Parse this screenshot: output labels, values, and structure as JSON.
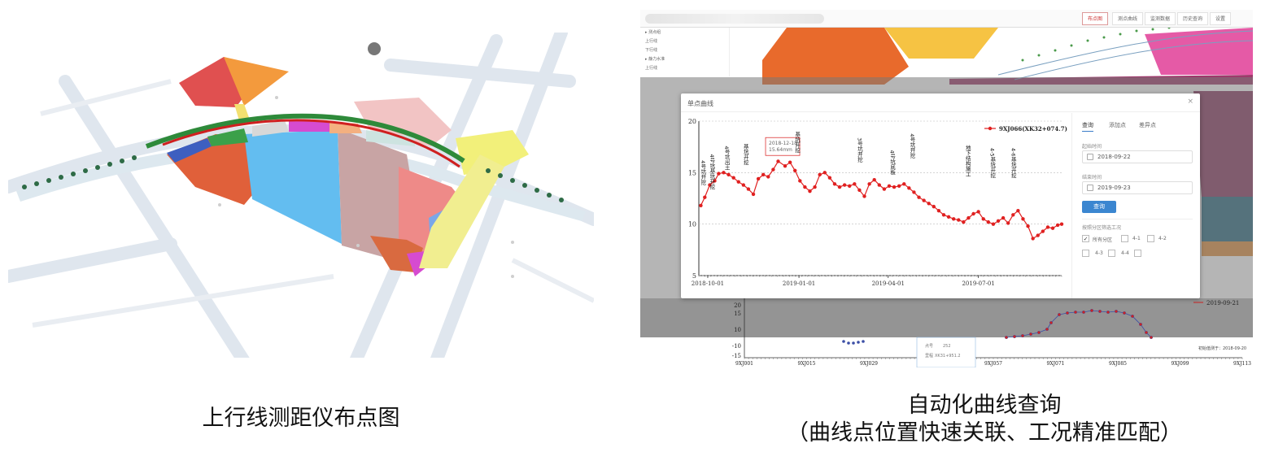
{
  "left_caption": "上行线测距仪布点图",
  "right_caption_line1": "自动化曲线查询",
  "right_caption_line2": "（曲线点位置快速关联、工况精准匹配）",
  "app_header": {
    "tabs": [
      "布点图",
      "测点曲线",
      "监测数据",
      "历史查询",
      "设置"
    ],
    "active_tab": 0
  },
  "sidebar": {
    "items": [
      "▸ 测点组",
      "上行线",
      "下行线",
      "▸ 静力水准",
      "上行线"
    ]
  },
  "modal": {
    "title": "单点曲线",
    "close": "×",
    "legend": "9XJ066(XK32+074.7)",
    "tooltip_date": "2018-12-18",
    "tooltip_value": "15.64mm",
    "y_ticks": [
      "20",
      "15",
      "10",
      "5"
    ],
    "x_ticks": [
      "2018-10-01",
      "2019-01-01",
      "2019-04-01",
      "2019-07-01"
    ]
  },
  "panel": {
    "tabs": [
      "查询",
      "添加点",
      "差异点"
    ],
    "start_label": "起始时间",
    "start_value": "2018-09-22",
    "end_label": "结束时间",
    "end_value": "2019-09-23",
    "query_button": "查询",
    "filter_label": "按照分区筛选工况",
    "checkboxes": [
      {
        "label": "所有分区",
        "checked": true
      },
      {
        "label": "4-1",
        "checked": false
      },
      {
        "label": "4-2",
        "checked": false
      },
      {
        "label": "4-3",
        "checked": false
      },
      {
        "label": "4-4",
        "checked": false
      }
    ]
  },
  "bottom_chart": {
    "legend": "2019-09-21",
    "y_ticks": [
      "20",
      "15",
      "10",
      "-10",
      "-15"
    ],
    "x_ticks": [
      "9XJ001",
      "9XJ015",
      "9XJ029",
      "9XJ043",
      "9XJ057",
      "9XJ071",
      "9XJ085",
      "9XJ099",
      "9XJ113"
    ],
    "note": "初始值测于：2018-09-20",
    "tooltip_row1_label": "点号",
    "tooltip_row1_value": "252",
    "tooltip_row2_label": "里程",
    "tooltip_row2_value": "XK31+951.2"
  },
  "chart_data": {
    "type": "line",
    "series": [
      {
        "name": "9XJ066(XK32+074.7)",
        "color": "#e02020",
        "x": [
          "2018-09-24",
          "2018-09-28",
          "2018-10-03",
          "2018-10-08",
          "2018-10-12",
          "2018-10-17",
          "2018-10-22",
          "2018-10-27",
          "2018-11-01",
          "2018-11-06",
          "2018-11-11",
          "2018-11-16",
          "2018-11-21",
          "2018-11-26",
          "2018-12-01",
          "2018-12-06",
          "2018-12-11",
          "2018-12-18",
          "2018-12-23",
          "2018-12-28",
          "2019-01-02",
          "2019-01-07",
          "2019-01-12",
          "2019-01-17",
          "2019-01-22",
          "2019-01-27",
          "2019-02-01",
          "2019-02-06",
          "2019-02-11",
          "2019-02-16",
          "2019-02-21",
          "2019-02-26",
          "2019-03-03",
          "2019-03-08",
          "2019-03-13",
          "2019-03-18",
          "2019-03-23",
          "2019-03-28",
          "2019-04-02",
          "2019-04-07",
          "2019-04-12",
          "2019-04-17",
          "2019-04-22",
          "2019-04-27",
          "2019-05-02",
          "2019-05-07",
          "2019-05-12",
          "2019-05-17",
          "2019-05-22",
          "2019-05-27",
          "2019-06-01",
          "2019-06-06",
          "2019-06-11",
          "2019-06-16",
          "2019-06-21",
          "2019-06-26",
          "2019-07-01",
          "2019-07-06",
          "2019-07-11",
          "2019-07-16",
          "2019-07-21",
          "2019-07-26",
          "2019-07-31",
          "2019-08-05",
          "2019-08-10",
          "2019-08-15",
          "2019-08-20",
          "2019-08-25",
          "2019-08-30",
          "2019-09-04",
          "2019-09-09",
          "2019-09-14",
          "2019-09-19",
          "2019-09-23"
        ],
        "y": [
          11.8,
          12.6,
          13.8,
          14.2,
          14.9,
          15.0,
          14.8,
          14.5,
          14.1,
          13.8,
          13.4,
          12.9,
          14.4,
          14.8,
          14.6,
          15.3,
          16.1,
          15.64,
          16.0,
          15.2,
          14.2,
          13.6,
          13.2,
          13.6,
          14.8,
          15.0,
          14.5,
          13.9,
          13.6,
          13.8,
          13.7,
          13.9,
          13.3,
          12.7,
          13.9,
          14.3,
          13.8,
          13.4,
          13.7,
          13.6,
          13.7,
          13.9,
          13.5,
          13.1,
          12.6,
          12.3,
          12.0,
          11.7,
          11.3,
          10.9,
          10.7,
          10.5,
          10.4,
          10.2,
          10.6,
          11.0,
          11.2,
          10.5,
          10.2,
          10.0,
          10.3,
          10.6,
          10.1,
          10.9,
          11.3,
          10.5,
          9.8,
          8.6,
          8.9,
          9.3,
          9.7,
          9.6,
          9.9,
          10.0
        ]
      }
    ],
    "ylim": [
      5,
      20
    ],
    "xlabel": "",
    "ylabel": "",
    "grid": true,
    "legend_position": "top-right",
    "annotations": [
      "4号坑开挖",
      "4号坑基坑开挖",
      "4号坑出土",
      "基坑开挖",
      "基坑开挖",
      "3号坑开挖",
      "4号坑底板",
      "4号坑开挖",
      "地下结构施工",
      "4-5基坑开挖",
      "4-6基坑开挖"
    ]
  },
  "colors": {
    "accent": "#3b86d0",
    "series": "#e02020",
    "bottom_series": "#3c4fa6"
  }
}
